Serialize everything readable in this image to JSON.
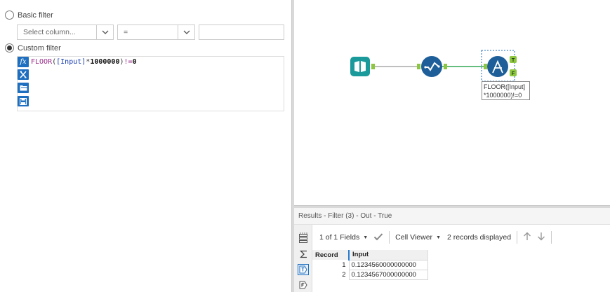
{
  "config": {
    "basic_filter": {
      "label": "Basic filter",
      "column_placeholder": "Select column...",
      "operator": "=",
      "value": ""
    },
    "custom_filter": {
      "label": "Custom filter",
      "expression_func": "FLOOR",
      "expression_open": "(",
      "expression_field": "[Input]",
      "expression_star": "*",
      "expression_number": "1000000",
      "expression_close": ")",
      "expression_op": "!=",
      "expression_zero": "0"
    }
  },
  "canvas": {
    "filter_annotation": [
      "FLOOR([Input]",
      "*1000000)!=0"
    ],
    "filter_true_anchor": "T",
    "filter_false_anchor": "F",
    "colors": {
      "input_tool": "#1a9a9a",
      "select_tool": "#1e5f9a",
      "filter_tool": "#1e5f9a",
      "connector": "#7ac943",
      "anchor": "#8dc63f"
    }
  },
  "results": {
    "title": "Results - Filter (3) - Out - True",
    "fields_selector": "1 of 1 Fields",
    "viewer": "Cell Viewer",
    "records_label": "2 records displayed",
    "columns": [
      "Record",
      "Input"
    ],
    "rows": [
      {
        "record": "1",
        "input": "0.1234560000000000"
      },
      {
        "record": "2",
        "input": "0.1234567000000000"
      }
    ]
  }
}
